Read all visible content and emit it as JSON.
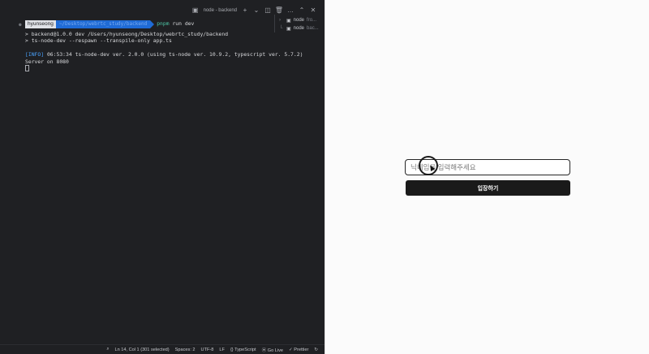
{
  "terminal": {
    "active_tab_title": "node - backend",
    "toolbar_icons": [
      "terminal-icon",
      "plus-icon",
      "chevron-down-icon",
      "split-icon",
      "trash-icon",
      "ellipsis-icon",
      "chevron-up-icon",
      "close-icon"
    ],
    "tabs": [
      {
        "name": "node",
        "suffix": "fro..."
      },
      {
        "name": "node",
        "suffix": "bac..."
      }
    ],
    "prompt": {
      "user": "hyunseong",
      "path": "~/Desktop/webrtc_study/backend",
      "command_pm": "pnpm",
      "command_rest": "run dev"
    },
    "output_lines": [
      "> backend@1.0.0 dev /Users/hyunseong/Desktop/webrtc_study/backend",
      "> ts-node-dev --respawn --transpile-only app.ts"
    ],
    "info_tag": "[INFO]",
    "info_rest": " 06:53:34 ts-node-dev ver. 2.0.0 (using ts-node ver. 10.9.2, typescript ver. 5.7.2)",
    "server_line": "Server on 8080"
  },
  "statusbar": {
    "cursor_position": "Ln 14, Col 1 (301 selected)",
    "spaces": "Spaces: 2",
    "encoding": "UTF-8",
    "eol": "LF",
    "language": "TypeScript",
    "go_live": "Go Live",
    "prettier": "Prettier"
  },
  "app": {
    "input_placeholder": "닉네임을 입력해주세요",
    "enter_button_label": "입장하기"
  }
}
